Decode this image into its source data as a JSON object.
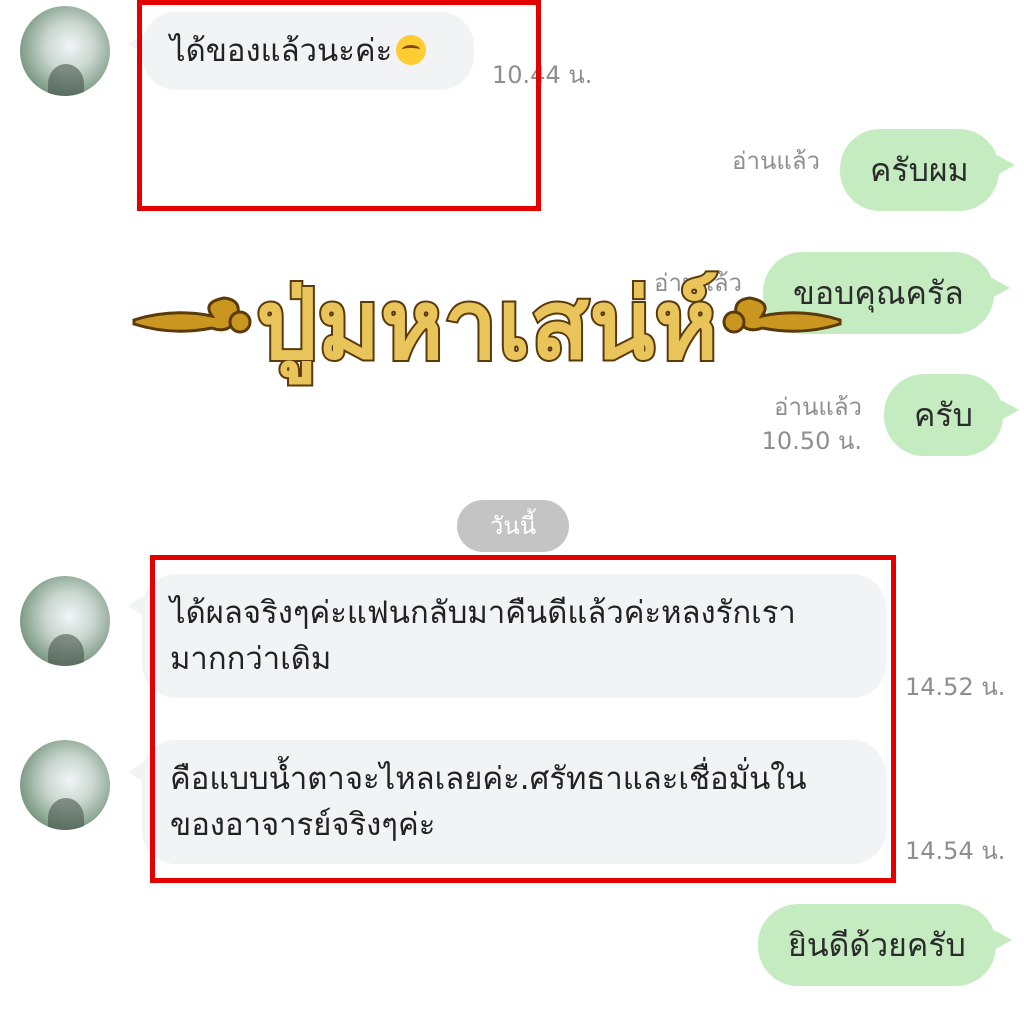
{
  "messages": [
    {
      "id": "m1",
      "side": "in",
      "text": "ได้ของแล้วนะค่ะ",
      "emoji": "smiling-face-icon",
      "time": "10.44 น."
    },
    {
      "id": "m2",
      "side": "out",
      "text": "ครับผม",
      "read": "อ่านแล้ว"
    },
    {
      "id": "m3",
      "side": "out",
      "text": "ขอบคุณครัล",
      "read": "อ่านแล้ว"
    },
    {
      "id": "m4",
      "side": "out",
      "text": "ครับ",
      "read": "อ่านแล้ว",
      "time": "10.50 น."
    },
    {
      "id": "m5",
      "side": "in",
      "line1": "ได้ผลจริงๆค่ะแฟนกลับมาคืนดีแล้วค่ะหลงรักเรา",
      "line2": "มากกว่าเดิม",
      "time": "14.52 น."
    },
    {
      "id": "m6",
      "side": "in",
      "line1": "คือแบบน้ำตาจะไหลเลยค่ะ.ศรัทธาและเชื่อมั่นใน",
      "line2": "ของอาจารย์จริงๆค่ะ",
      "time": "14.54 น."
    },
    {
      "id": "m7",
      "side": "out",
      "text": "ยินดีด้วยครับ"
    }
  ],
  "date_divider": "วันนี้",
  "watermark": {
    "text": "ปู่มหาเสน่ห์",
    "color_fill": "#e8c45a",
    "color_stroke": "#5a3a0a"
  },
  "colors": {
    "incoming_bubble": "#f2f3f5",
    "outgoing_bubble": "#c5ecc0",
    "highlight_box": "#e50000",
    "meta_text": "#8e8e8e"
  }
}
